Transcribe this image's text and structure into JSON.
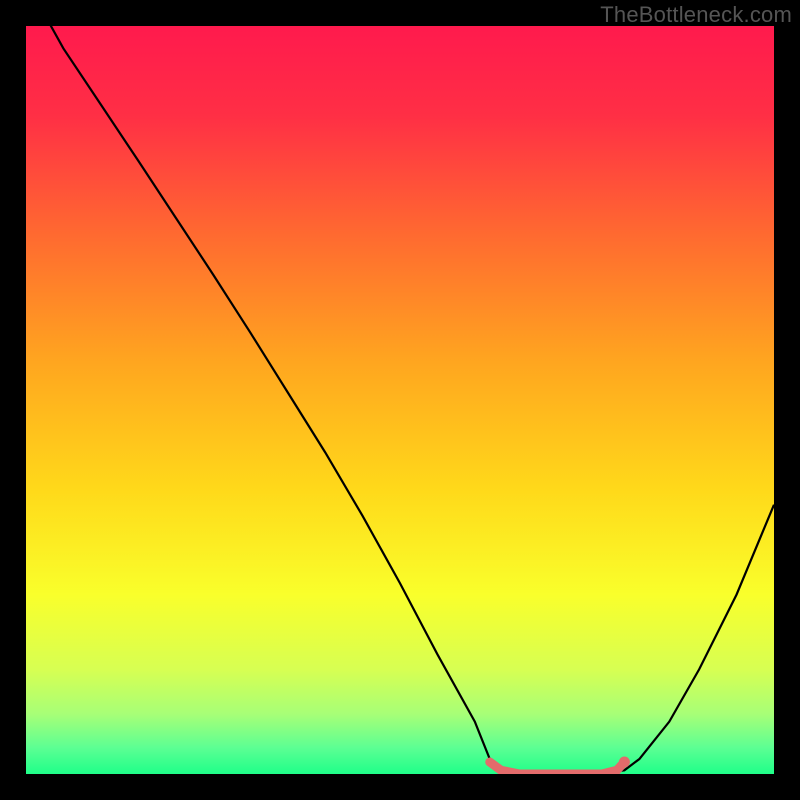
{
  "watermark": "TheBottleneck.com",
  "gradient_stops": [
    {
      "offset": 0.0,
      "color": "#ff1a4d"
    },
    {
      "offset": 0.12,
      "color": "#ff2f45"
    },
    {
      "offset": 0.28,
      "color": "#ff6a30"
    },
    {
      "offset": 0.45,
      "color": "#ffa61f"
    },
    {
      "offset": 0.62,
      "color": "#ffd91a"
    },
    {
      "offset": 0.76,
      "color": "#f9ff2b"
    },
    {
      "offset": 0.86,
      "color": "#d7ff52"
    },
    {
      "offset": 0.92,
      "color": "#a7ff77"
    },
    {
      "offset": 0.965,
      "color": "#5cff93"
    },
    {
      "offset": 1.0,
      "color": "#1fff89"
    }
  ],
  "chart_data": {
    "type": "line",
    "title": "",
    "xlabel": "",
    "ylabel": "",
    "xlim": [
      0,
      100
    ],
    "ylim": [
      0,
      100
    ],
    "series": [
      {
        "name": "bottleneck-curve",
        "color": "#000000",
        "stroke_width": 2.2,
        "x": [
          0,
          5,
          10,
          15,
          20,
          25,
          30,
          35,
          40,
          45,
          50,
          55,
          60,
          62,
          65,
          68,
          72,
          76,
          80,
          82,
          86,
          90,
          95,
          100
        ],
        "y": [
          106,
          97,
          89.5,
          82,
          74.4,
          66.8,
          59,
          51,
          43,
          34.5,
          25.5,
          16,
          7,
          2,
          0,
          0,
          0,
          0,
          0.5,
          2,
          7,
          14,
          24,
          36
        ]
      },
      {
        "name": "optimal-range",
        "color": "#e36b6b",
        "stroke_width": 9,
        "linecap": "round",
        "x": [
          62,
          63.5,
          66,
          70,
          74,
          77,
          79,
          80
        ],
        "y": [
          1.6,
          0.5,
          0,
          0,
          0,
          0,
          0.5,
          1.6
        ]
      }
    ],
    "markers": [
      {
        "name": "optimal-dot",
        "x": 80,
        "y": 1.6,
        "r": 5.5,
        "color": "#e36b6b"
      }
    ]
  }
}
